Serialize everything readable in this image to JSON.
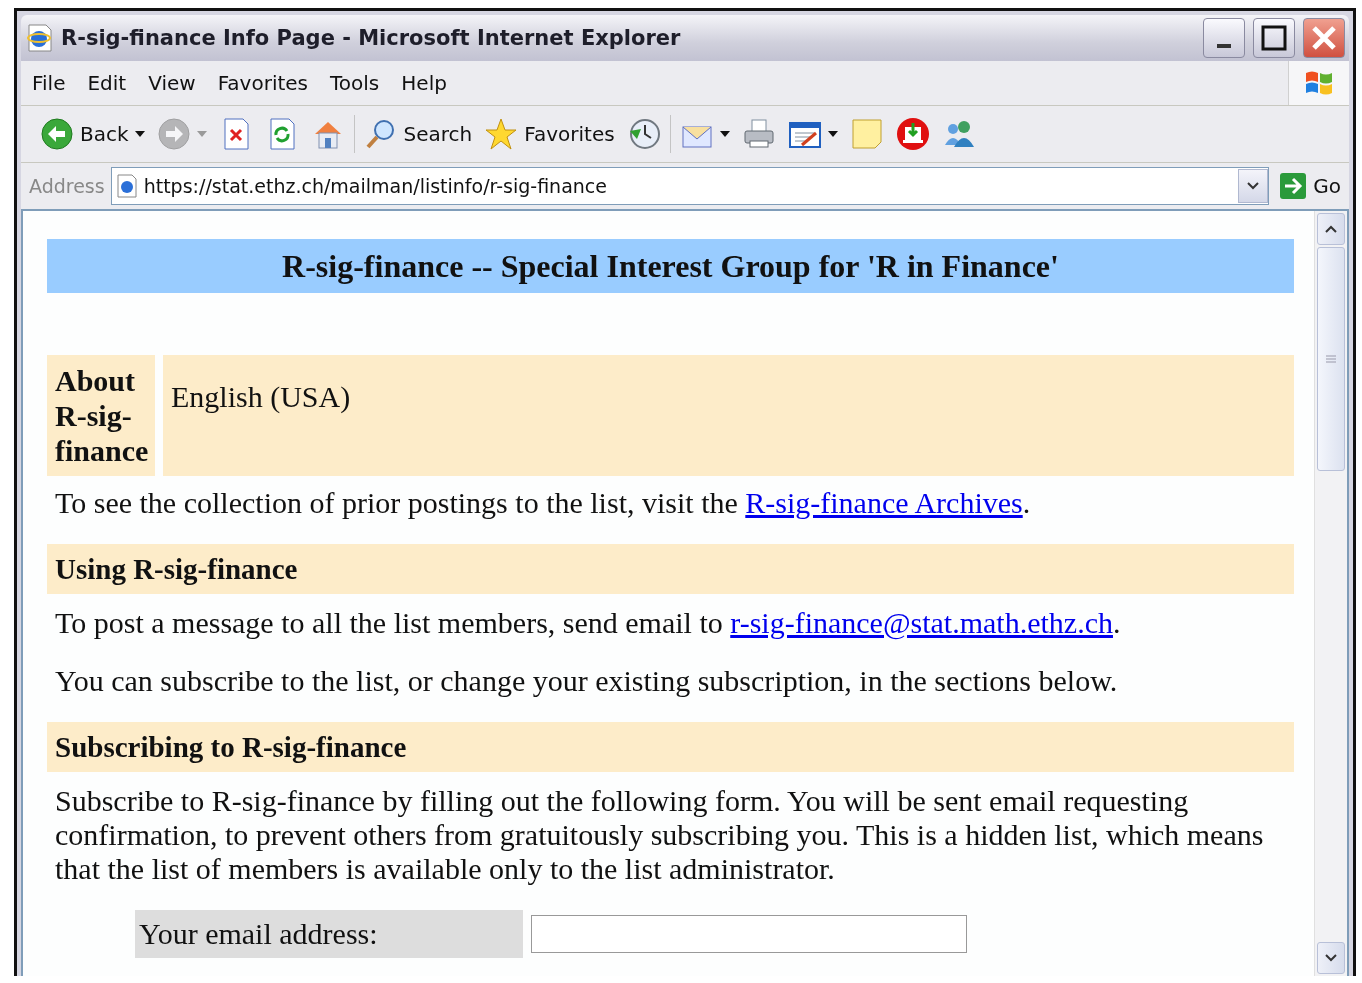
{
  "window": {
    "title": "R-sig-finance Info Page - Microsoft Internet Explorer"
  },
  "menu": [
    "File",
    "Edit",
    "View",
    "Favorites",
    "Tools",
    "Help"
  ],
  "toolbar": [
    [
      {
        "kind": "back",
        "label": "Back",
        "dropdown": true,
        "disabled": false
      },
      {
        "kind": "forward",
        "dropdown": true,
        "disabled": true
      },
      {
        "kind": "stop",
        "disabled": false
      },
      {
        "kind": "refresh",
        "disabled": false
      },
      {
        "kind": "home",
        "disabled": false
      }
    ],
    [
      {
        "kind": "search",
        "label": "Search",
        "disabled": false
      },
      {
        "kind": "favorites",
        "label": "Favorites",
        "disabled": false
      },
      {
        "kind": "history",
        "disabled": false
      }
    ],
    [
      {
        "kind": "mail",
        "dropdown": true,
        "disabled": false
      },
      {
        "kind": "print",
        "disabled": false
      },
      {
        "kind": "edit",
        "dropdown": true,
        "disabled": false
      },
      {
        "kind": "note",
        "disabled": false
      },
      {
        "kind": "download",
        "disabled": false
      },
      {
        "kind": "messenger",
        "disabled": false
      }
    ]
  ],
  "address": {
    "label": "Address",
    "value": "https://stat.ethz.ch/mailman/listinfo/r-sig-finance",
    "go": "Go"
  },
  "page": {
    "heading": "R-sig-finance -- Special Interest Group for 'R in Finance'",
    "about": {
      "label": "About R-sig-finance",
      "value": "English (USA)"
    },
    "blocks": [
      {
        "kind": "paragraph",
        "text": "To see the collection of prior postings to the list, visit the ",
        "link": "R-sig-finance Archives",
        "after": "."
      },
      {
        "kind": "heading",
        "text": "Using R-sig-finance"
      },
      {
        "kind": "paragraph",
        "text": "To post a message to all the list members, send email to ",
        "link": "r-sig-finance@stat.math.ethz.ch",
        "after": "."
      },
      {
        "kind": "paragraph",
        "text": "You can subscribe to the list, or change your existing subscription, in the sections below."
      },
      {
        "kind": "heading",
        "text": "Subscribing to R-sig-finance"
      },
      {
        "kind": "paragraph",
        "text": "Subscribe to R-sig-finance by filling out the following form. You will be sent email requesting confirmation, to prevent others from gratuitously subscribing you. This is a hidden list, which means that the list of members is available only to the list administrator."
      }
    ],
    "form": [
      {
        "label": "Your email address:"
      }
    ]
  }
}
